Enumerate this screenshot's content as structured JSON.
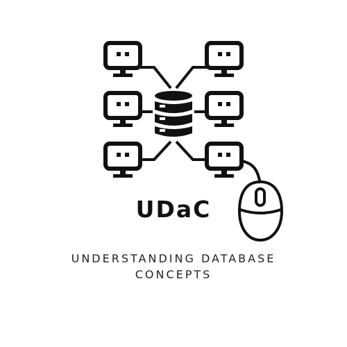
{
  "brand": {
    "name": "UDaC",
    "tagline_line1": "UNDERSTANDING DATABASE",
    "tagline_line2": "CONCEPTS"
  },
  "icons": {
    "computers": [
      "computer-icon",
      "computer-icon",
      "computer-icon",
      "computer-icon",
      "computer-icon",
      "computer-icon"
    ],
    "center": "database-icon",
    "pointer": "mouse-icon"
  },
  "colors": {
    "ink": "#111111",
    "background": "#ffffff"
  }
}
